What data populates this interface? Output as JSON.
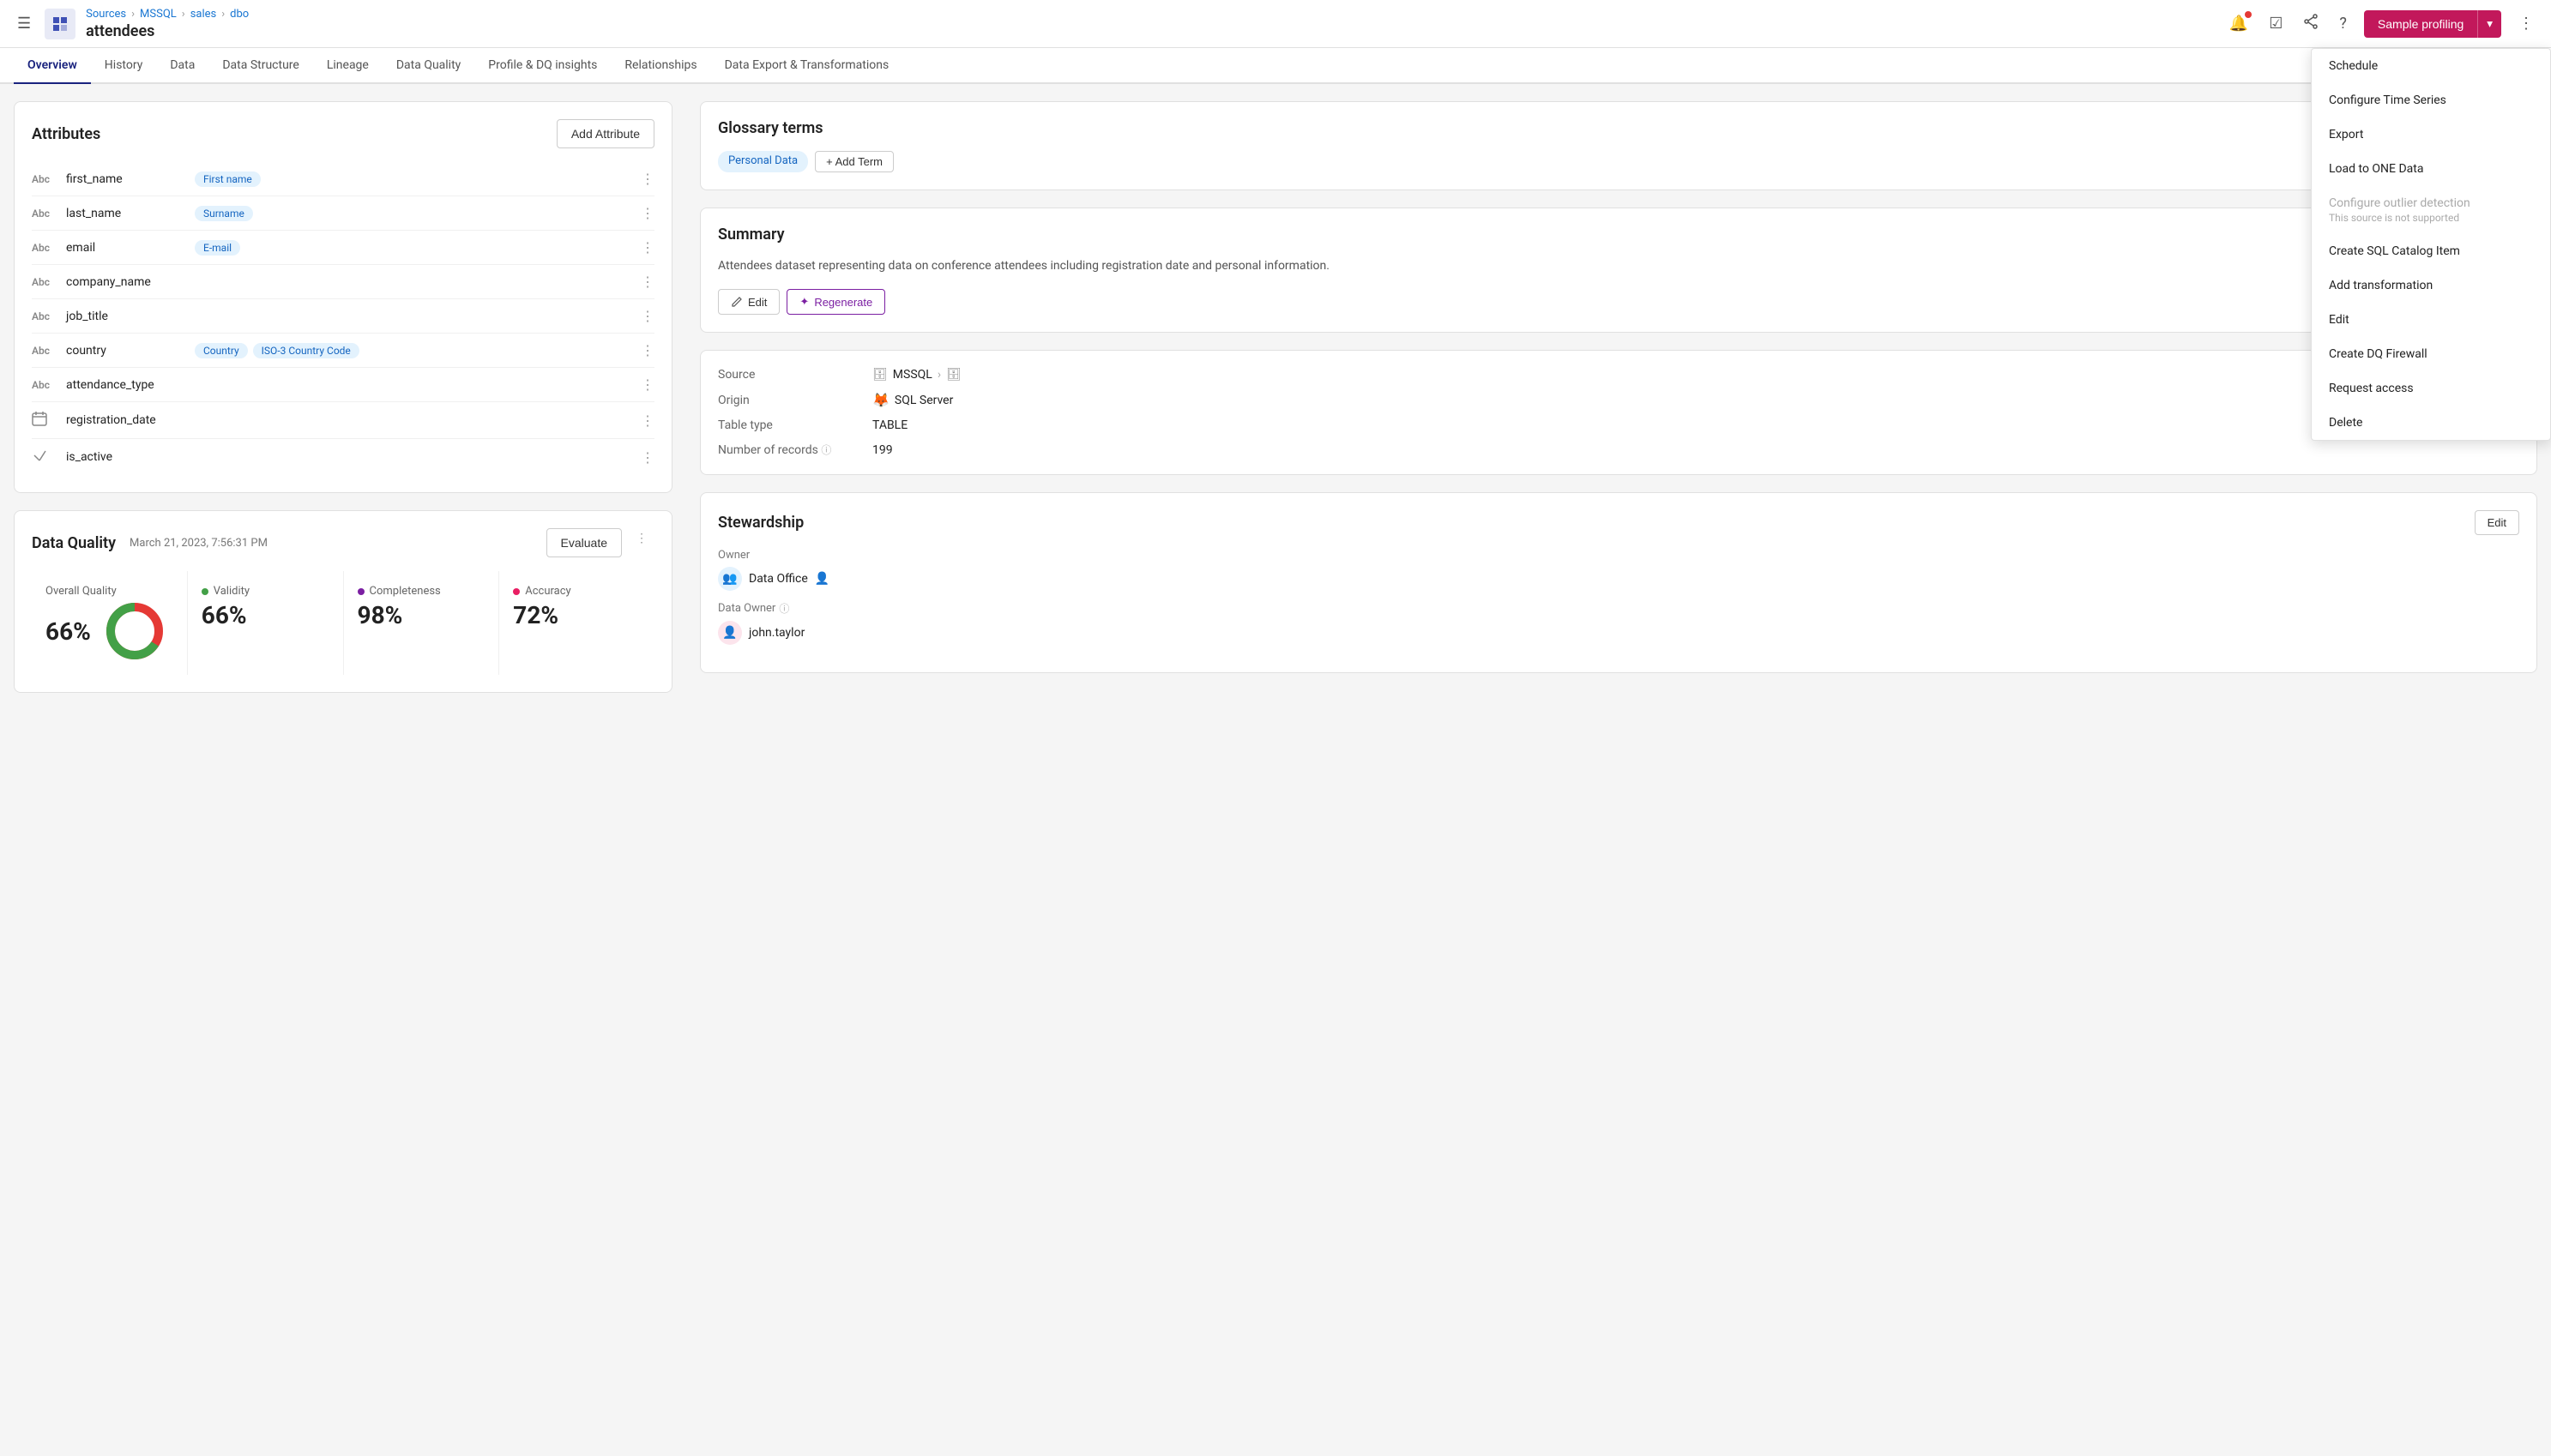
{
  "topbar": {
    "breadcrumb": [
      "Sources",
      "MSSQL",
      "sales",
      "dbo"
    ],
    "entity_name": "attendees",
    "sample_profiling_label": "Sample profiling",
    "dropdown_arrow": "▾"
  },
  "tabs": [
    {
      "label": "Overview",
      "active": true
    },
    {
      "label": "History",
      "active": false
    },
    {
      "label": "Data",
      "active": false
    },
    {
      "label": "Data Structure",
      "active": false
    },
    {
      "label": "Lineage",
      "active": false
    },
    {
      "label": "Data Quality",
      "active": false
    },
    {
      "label": "Profile & DQ insights",
      "active": false
    },
    {
      "label": "Relationships",
      "active": false
    },
    {
      "label": "Data Export & Transformations",
      "active": false
    }
  ],
  "attributes": {
    "title": "Attributes",
    "add_button": "Add Attribute",
    "items": [
      {
        "name": "first_name",
        "type": "Abc",
        "tags": [
          {
            "label": "First name",
            "style": "blue"
          }
        ]
      },
      {
        "name": "last_name",
        "type": "Abc",
        "tags": [
          {
            "label": "Surname",
            "style": "blue"
          }
        ]
      },
      {
        "name": "email",
        "type": "Abc",
        "tags": [
          {
            "label": "E-mail",
            "style": "blue"
          }
        ]
      },
      {
        "name": "company_name",
        "type": "Abc",
        "tags": []
      },
      {
        "name": "job_title",
        "type": "Abc",
        "tags": []
      },
      {
        "name": "country",
        "type": "Abc",
        "tags": [
          {
            "label": "Country",
            "style": "blue"
          },
          {
            "label": "ISO-3 Country Code",
            "style": "blue"
          }
        ]
      },
      {
        "name": "attendance_type",
        "type": "Abc",
        "tags": []
      },
      {
        "name": "registration_date",
        "type": "cal",
        "tags": []
      },
      {
        "name": "is_active",
        "type": "bool",
        "tags": []
      }
    ]
  },
  "data_quality": {
    "title": "Data Quality",
    "date": "March 21, 2023, 7:56:31 PM",
    "evaluate_label": "Evaluate",
    "metrics": [
      {
        "label": "Overall Quality",
        "value": "66%",
        "dot": "none",
        "has_donut": true,
        "green_pct": 66
      },
      {
        "label": "Validity",
        "value": "66%",
        "dot": "green"
      },
      {
        "label": "Completeness",
        "value": "98%",
        "dot": "purple"
      },
      {
        "label": "Accuracy",
        "value": "72%",
        "dot": "pink"
      }
    ]
  },
  "glossary": {
    "title": "Glossary terms",
    "tags": [
      "Personal Data"
    ],
    "add_term_label": "+ Add Term"
  },
  "summary": {
    "title": "Summary",
    "text": "Attendees dataset representing data on conference attendees including registration date and personal information.",
    "edit_label": "Edit",
    "regenerate_label": "Regenerate"
  },
  "source_info": {
    "rows": [
      {
        "label": "Source",
        "value": "MSSQL",
        "has_db_icon": true
      },
      {
        "label": "Origin",
        "value": "SQL Server",
        "has_sql_icon": true
      },
      {
        "label": "Table type",
        "value": "TABLE"
      },
      {
        "label": "Number of records",
        "value": "199",
        "has_info": true
      }
    ]
  },
  "stewardship": {
    "title": "Stewardship",
    "edit_label": "Edit",
    "owner_label": "Owner",
    "owner_value": "Data Office",
    "data_owner_label": "Data Owner",
    "data_owner_value": "john.taylor"
  },
  "dropdown_menu": {
    "items": [
      {
        "label": "Schedule",
        "disabled": false
      },
      {
        "label": "Configure Time Series",
        "disabled": false
      },
      {
        "label": "Export",
        "disabled": false
      },
      {
        "label": "Load to ONE Data",
        "disabled": false
      },
      {
        "label": "Configure outlier detection",
        "sub": "This source is not supported",
        "disabled": true
      },
      {
        "label": "Create SQL Catalog Item",
        "disabled": false
      },
      {
        "label": "Add transformation",
        "disabled": false
      },
      {
        "label": "Edit",
        "disabled": false
      },
      {
        "label": "Create DQ Firewall",
        "disabled": false
      },
      {
        "label": "Request access",
        "disabled": false
      },
      {
        "label": "Delete",
        "disabled": false
      }
    ]
  }
}
